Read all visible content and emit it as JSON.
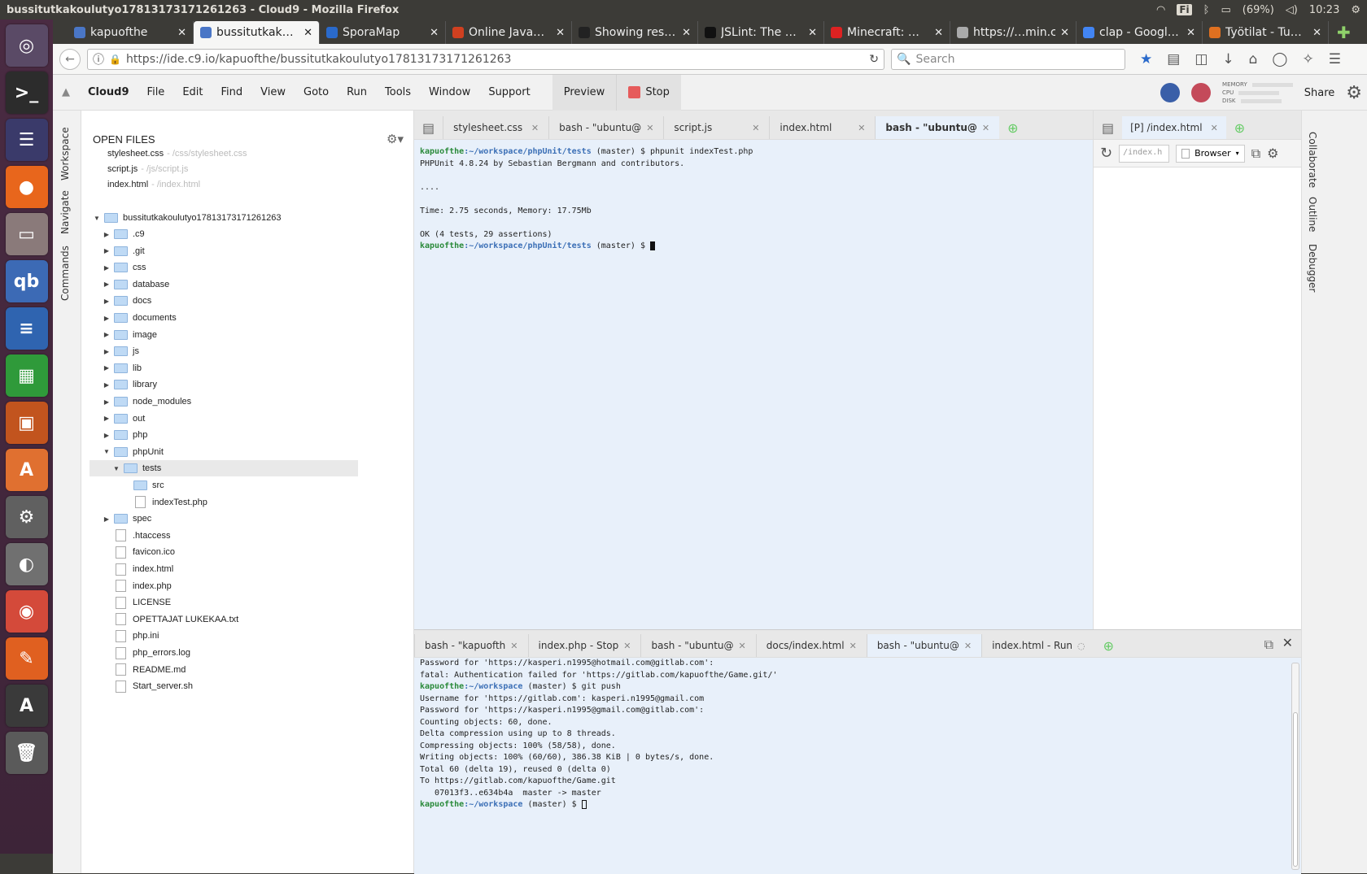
{
  "window_title": "bussitutkakoulutyo17813173171261263 - Cloud9 - Mozilla Firefox",
  "system": {
    "keyboard": "Fi",
    "battery": "(69%)",
    "clock": "10:23"
  },
  "launcher": [
    {
      "name": "ubuntu-dash-icon",
      "glyph": "◎",
      "color": "#5a4a66"
    },
    {
      "name": "terminal-icon",
      "glyph": ">_",
      "color": "#2c2c2c"
    },
    {
      "name": "eclipse-icon",
      "glyph": "☰",
      "color": "#3a3a6a"
    },
    {
      "name": "firefox-icon",
      "glyph": "●",
      "color": "#e8661c"
    },
    {
      "name": "files-icon",
      "glyph": "▭",
      "color": "#8a7a7a"
    },
    {
      "name": "qbittorrent-icon",
      "glyph": "qb",
      "color": "#3c6ab5"
    },
    {
      "name": "writer-icon",
      "glyph": "≡",
      "color": "#2f64b0"
    },
    {
      "name": "calc-icon",
      "glyph": "▦",
      "color": "#2f9a3a"
    },
    {
      "name": "impress-icon",
      "glyph": "▣",
      "color": "#c2541e"
    },
    {
      "name": "software-center-icon",
      "glyph": "A",
      "color": "#e07030"
    },
    {
      "name": "system-settings-icon",
      "glyph": "⚙",
      "color": "#606060"
    },
    {
      "name": "disk-icon",
      "glyph": "◐",
      "color": "#707070"
    },
    {
      "name": "chrome-icon",
      "glyph": "◉",
      "color": "#d44a3a"
    },
    {
      "name": "drawing-icon",
      "glyph": "✎",
      "color": "#e06020"
    },
    {
      "name": "updater-icon",
      "glyph": "A",
      "color": "#3a3a3a"
    },
    {
      "name": "trash-icon",
      "glyph": "🗑",
      "color": "#5a5a5a"
    }
  ],
  "browser_tabs": [
    {
      "label": "kapuofthe",
      "fav": "#4a76c6"
    },
    {
      "label": "bussitutkak…",
      "fav": "#4a76c6"
    },
    {
      "label": "SporaMap",
      "fav": "#2a6acb"
    },
    {
      "label": "Online Java…",
      "fav": "#d04020"
    },
    {
      "label": "Showing res…",
      "fav": "#222222"
    },
    {
      "label": "JSLint: The …",
      "fav": "#111111"
    },
    {
      "label": "Minecraft: …",
      "fav": "#dd2222"
    },
    {
      "label": "https://…min.css",
      "fav": "#aaaaaa"
    },
    {
      "label": "clap - Googl…",
      "fav": "#4285f4"
    },
    {
      "label": "Työtilat - Tu…",
      "fav": "#e07020"
    }
  ],
  "url": "https://ide.c9.io/kapuofthe/bussitutkakoulutyo17813173171261263",
  "search_placeholder": "Search",
  "menu": {
    "brand": "Cloud9",
    "items": [
      "File",
      "Edit",
      "Find",
      "View",
      "Goto",
      "Run",
      "Tools",
      "Window",
      "Support"
    ],
    "preview": "Preview",
    "stop": "Stop",
    "share": "Share",
    "meters": [
      "MEMORY",
      "CPU",
      "DISK"
    ]
  },
  "left_rail": [
    "Workspace",
    "Navigate",
    "Commands"
  ],
  "right_rail": [
    "Collaborate",
    "Outline",
    "Debugger"
  ],
  "open_files": {
    "header": "OPEN FILES",
    "items": [
      {
        "name": "stylesheet.css",
        "path": "- /css/stylesheet.css"
      },
      {
        "name": "script.js",
        "path": "- /js/script.js"
      },
      {
        "name": "index.html",
        "path": "- /index.html"
      }
    ]
  },
  "tree": {
    "root": "bussitutkakoulutyo17813173171261263",
    "items": [
      {
        "label": ".c9",
        "kind": "folder"
      },
      {
        "label": ".git",
        "kind": "folder"
      },
      {
        "label": "css",
        "kind": "folder"
      },
      {
        "label": "database",
        "kind": "folder"
      },
      {
        "label": "docs",
        "kind": "folder"
      },
      {
        "label": "documents",
        "kind": "folder"
      },
      {
        "label": "image",
        "kind": "folder"
      },
      {
        "label": "js",
        "kind": "folder"
      },
      {
        "label": "lib",
        "kind": "folder"
      },
      {
        "label": "library",
        "kind": "folder"
      },
      {
        "label": "node_modules",
        "kind": "folder"
      },
      {
        "label": "out",
        "kind": "folder"
      },
      {
        "label": "php",
        "kind": "folder"
      },
      {
        "label": "phpUnit",
        "kind": "folder-open"
      },
      {
        "label": "tests",
        "kind": "folder-open"
      },
      {
        "label": "src",
        "kind": "folder"
      },
      {
        "label": "indexTest.php",
        "kind": "file"
      },
      {
        "label": "spec",
        "kind": "folder"
      },
      {
        "label": ".htaccess",
        "kind": "file"
      },
      {
        "label": "favicon.ico",
        "kind": "file"
      },
      {
        "label": "index.html",
        "kind": "file"
      },
      {
        "label": "index.php",
        "kind": "file"
      },
      {
        "label": "LICENSE",
        "kind": "file"
      },
      {
        "label": "OPETTAJAT LUKEKAA.txt",
        "kind": "file"
      },
      {
        "label": "php.ini",
        "kind": "file"
      },
      {
        "label": "php_errors.log",
        "kind": "file"
      },
      {
        "label": "README.md",
        "kind": "file"
      },
      {
        "label": "Start_server.sh",
        "kind": "file"
      }
    ]
  },
  "editor_tabs": [
    "stylesheet.css",
    "bash - \"ubuntu@",
    "script.js",
    "index.html",
    "bash - \"ubuntu@"
  ],
  "terminal_top": {
    "user": "kapuofthe",
    "path1": ":~/workspace/phpUnit/tests",
    "cmd1": " (master) $ phpunit indexTest.php",
    "out": [
      "PHPUnit 4.8.24 by Sebastian Bergmann and contributors.",
      "",
      "....",
      "",
      "Time: 2.75 seconds, Memory: 17.75Mb",
      "",
      "OK (4 tests, 29 assertions)"
    ],
    "cmd2": " (master) $ "
  },
  "preview": {
    "tab": "[P] /index.html",
    "input": "/index.h",
    "select": "Browser"
  },
  "bottom_tabs": [
    "bash - \"kapuofth",
    "index.php - Stop",
    "bash - \"ubuntu@",
    "docs/index.html",
    "bash - \"ubuntu@",
    "index.html - Run"
  ],
  "terminal_bottom": {
    "lines": [
      "Password for 'https://kasperi.n1995@hotmail.com@gitlab.com':",
      "fatal: Authentication failed for 'https://gitlab.com/kapuofthe/Game.git/'"
    ],
    "user": "kapuofthe",
    "path": ":~/workspace",
    "cmd": " (master) $ git push",
    "lines2": [
      "Username for 'https://gitlab.com': kasperi.n1995@gmail.com",
      "Password for 'https://kasperi.n1995@gmail.com@gitlab.com':",
      "Counting objects: 60, done.",
      "Delta compression using up to 8 threads.",
      "Compressing objects: 100% (58/58), done.",
      "Writing objects: 100% (60/60), 386.38 KiB | 0 bytes/s, done.",
      "Total 60 (delta 19), reused 0 (delta 0)",
      "To https://gitlab.com/kapuofthe/Game.git",
      "   07013f3..e634b4a  master -> master"
    ],
    "prompt_end": " (master) $ "
  }
}
